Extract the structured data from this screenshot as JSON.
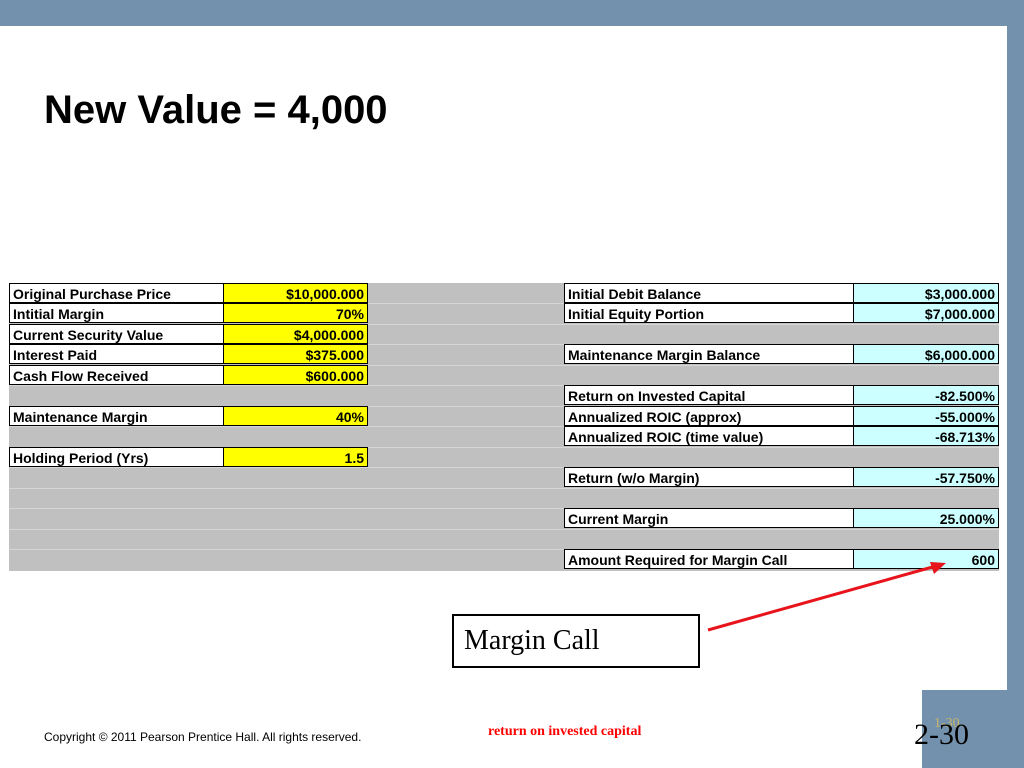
{
  "title": "New Value = 4,000",
  "left_table": [
    {
      "label": "Original Purchase Price",
      "value": "$10,000.000"
    },
    {
      "label": "Intitial Margin",
      "value": "70%"
    },
    {
      "label": "Current Security Value",
      "value": "$4,000.000"
    },
    {
      "label": "Interest Paid",
      "value": "$375.000"
    },
    {
      "label": "Cash Flow Received",
      "value": "$600.000"
    },
    {
      "label": "Maintenance Margin",
      "value": "40%"
    },
    {
      "label": "Holding Period (Yrs)",
      "value": "1.5"
    }
  ],
  "right_table": [
    {
      "label": "Initial Debit Balance",
      "value": "$3,000.000"
    },
    {
      "label": "Initial Equity Portion",
      "value": "$7,000.000"
    },
    {
      "label": "Maintenance Margin Balance",
      "value": "$6,000.000"
    },
    {
      "label": "Return on Invested Capital",
      "value": "-82.500%"
    },
    {
      "label": "Annualized ROIC (approx)",
      "value": "-55.000%"
    },
    {
      "label": "Annualized ROIC (time value)",
      "value": "-68.713%"
    },
    {
      "label": "Return (w/o Margin)",
      "value": "-57.750%"
    },
    {
      "label": "Current Margin",
      "value": "25.000%"
    },
    {
      "label": "Amount Required for Margin Call",
      "value": "600"
    }
  ],
  "callout": "Margin Call",
  "footer": {
    "copyright": "Copyright © 2011 Pearson Prentice Hall. All rights reserved.",
    "note": "return on invested capital",
    "ghost_number": "1-30",
    "page_number": "2-30"
  },
  "colors": {
    "bar": "#7391ac",
    "input_cell": "#ffff00",
    "output_cell": "#ccffff",
    "sheet_background": "#c0c0c0",
    "arrow": "#e8141c",
    "note": "#ff0000"
  }
}
